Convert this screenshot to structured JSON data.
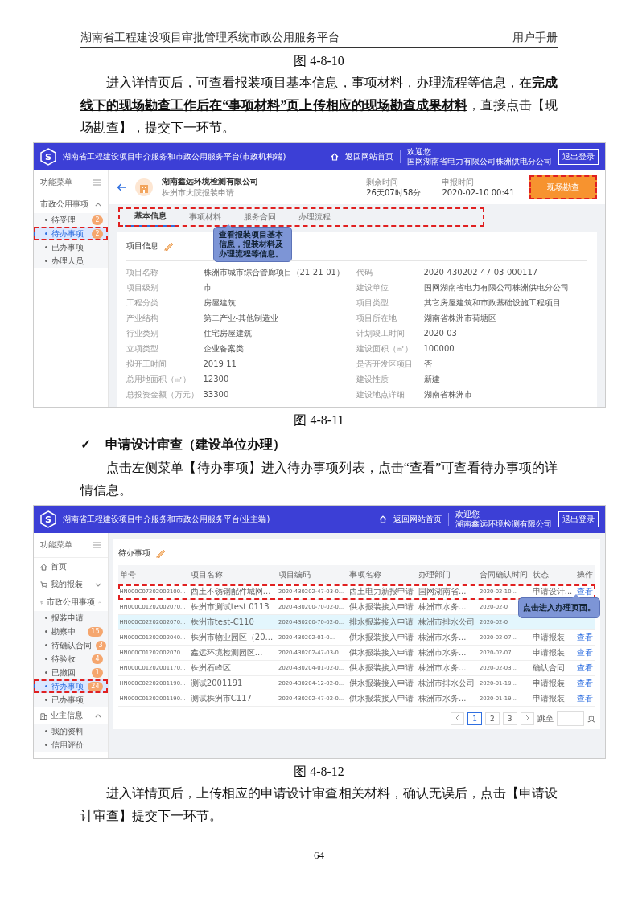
{
  "doc_header": {
    "title": "湖南省工程建设项目审批管理系统市政公用服务平台",
    "right": "用户手册"
  },
  "blocks": [
    {
      "kind": "caption",
      "text": "图 4-8-10"
    },
    {
      "kind": "paragraph",
      "text": "进入详情页后，可查看报装项目基本信息，事项材料，办理流程等信息，在**完成线下的现场勘查工作后在“事项材料”页上传相应的现场勘查成果材料**，直接点击【现场勘查】，提交下一环节。"
    },
    {
      "kind": "detail_screen",
      "app": {
        "logo": "S",
        "title": "湖南省工程建设项目中介服务和市政公用服务平台(市政机构端)",
        "home_link": "返回网站首页",
        "welcome": "欢迎您",
        "user": "国网湖南省电力有限公司株洲供电分公司",
        "logout": "退出登录"
      },
      "sidebar": {
        "title": "功能菜单",
        "items": [
          {
            "label": "市政公用事项",
            "kind": "plain",
            "expanded": true,
            "children": [
              {
                "label": "待受理",
                "badge": "2",
                "selected": false,
                "annotated": false
              },
              {
                "label": "待办事项",
                "badge": "2",
                "selected": true,
                "annotated": true
              },
              {
                "label": "已办事项",
                "selected": false,
                "annotated": false
              },
              {
                "label": "办理人员",
                "selected": false,
                "annotated": false
              }
            ]
          }
        ]
      },
      "company": "湖南鑫远环境检测有限公司",
      "subtitle": "株洲市大院报装申请",
      "stats": [
        {
          "label": "剩余时间",
          "value": "26天07时58分"
        },
        {
          "label": "申报时间",
          "value": "2020-02-10 00:41"
        }
      ],
      "action": {
        "label": "现场勘查",
        "annotated": true
      },
      "tabs_annotated": true,
      "tabs": [
        {
          "label": "基本信息",
          "selected": true
        },
        {
          "label": "事项材料",
          "selected": false
        },
        {
          "label": "服务合同",
          "selected": false
        },
        {
          "label": "办理流程",
          "selected": false
        }
      ],
      "callout": "查看报装项目基本信息，报装材料及办理流程等信息。",
      "card_title": "项目信息",
      "fields": [
        {
          "label": "项目名称",
          "value": "株洲市城市综合管廊项目（21-21-01）"
        },
        {
          "label": "代码",
          "value": "2020-430202-47-03-000117"
        },
        {
          "label": "项目级别",
          "value": "市"
        },
        {
          "label": "建设单位",
          "value": "国网湖南省电力有限公司株洲供电分公司"
        },
        {
          "label": "工程分类",
          "value": "房屋建筑"
        },
        {
          "label": "项目类型",
          "value": "其它房屋建筑和市政基础设施工程项目"
        },
        {
          "label": "产业结构",
          "value": "第二产业-其他制造业"
        },
        {
          "label": "项目所在地",
          "value": "湖南省株洲市荷塘区"
        },
        {
          "label": "行业类别",
          "value": "住宅房屋建筑"
        },
        {
          "label": "计划竣工时间",
          "value": "2020 03"
        },
        {
          "label": "立项类型",
          "value": "企业备案类"
        },
        {
          "label": "建设面积（㎡）",
          "value": "100000"
        },
        {
          "label": "拟开工时间",
          "value": "2019 11"
        },
        {
          "label": "是否开发区项目",
          "value": "否"
        },
        {
          "label": "总用地面积（㎡）",
          "value": "12300"
        },
        {
          "label": "建设性质",
          "value": "新建"
        },
        {
          "label": "总投资金额（万元）",
          "value": "33300"
        },
        {
          "label": "建设地点详细",
          "value": "湖南省株洲市"
        }
      ]
    },
    {
      "kind": "caption",
      "text": "图 4-8-11"
    },
    {
      "kind": "heading",
      "mark": "✓",
      "text": "申请设计审查（建设单位办理）"
    },
    {
      "kind": "paragraph",
      "text": "点击左侧菜单【待办事项】进入待办事项列表，点击“查看”可查看待办事项的详情信息。"
    },
    {
      "kind": "list_screen",
      "app": {
        "logo": "S",
        "title": "湖南省工程建设项目中介服务和市政公用服务平台(业主端)",
        "home_link": "返回网站首页",
        "welcome": "欢迎您",
        "user": "湖南鑫远环境检测有限公司",
        "logout": "退出登录"
      },
      "sidebar": {
        "title": "功能菜单",
        "items": [
          {
            "label": "首页",
            "kind": "home"
          },
          {
            "label": "我的报装",
            "kind": "cart",
            "expanded": false
          },
          {
            "label": "市政公用事项",
            "kind": "cart",
            "expanded": true,
            "children": [
              {
                "label": "报装申请",
                "selected": false,
                "annotated": false
              },
              {
                "label": "勘察中",
                "badge": "15",
                "selected": false,
                "annotated": false
              },
              {
                "label": "待确认合同",
                "badge": "3",
                "selected": false,
                "annotated": false
              },
              {
                "label": "待验收",
                "badge": "4",
                "selected": false,
                "annotated": false
              },
              {
                "label": "已撤回",
                "badge": "1",
                "selected": false,
                "annotated": false
              },
              {
                "label": "待办事项",
                "badge": "24",
                "selected": true,
                "annotated": true
              },
              {
                "label": "已办事项",
                "selected": false,
                "annotated": false
              }
            ]
          },
          {
            "label": "业主信息",
            "kind": "building",
            "expanded": true,
            "children": [
              {
                "label": "我的资料",
                "selected": false,
                "annotated": false
              },
              {
                "label": "信用评价",
                "selected": false,
                "annotated": false
              }
            ]
          }
        ]
      },
      "page_title": "待办事项",
      "columns": [
        "单号",
        "项目名称",
        "项目编码",
        "事项名称",
        "办理部门",
        "合同确认时间",
        "状态",
        "操作"
      ],
      "rows": [
        {
          "highlighted": false,
          "annotated": true,
          "cells": [
            "HN000C07202002100...",
            "西土不锈钢配件城网...",
            "2020-430202-47-03-0...",
            "西土电力新报申请",
            "国网湖南省...",
            "2020-02-10...",
            "申请设计...",
            "查看"
          ]
        },
        {
          "highlighted": false,
          "annotated": false,
          "cells": [
            "HN000C01202002070...",
            "株洲市测试test 0113",
            "2020-430200-70-02-0...",
            "供水报装接入申请",
            "株洲市水务...",
            "2020-02-0",
            null,
            null
          ]
        },
        {
          "highlighted": true,
          "annotated": false,
          "cells": [
            "HN000C02202002070...",
            "株洲市test-C110",
            "2020-430200-70-02-0...",
            "排水报装接入申请",
            "株洲市排水公司",
            "2020-02-0",
            null,
            null
          ]
        },
        {
          "highlighted": false,
          "annotated": false,
          "cells": [
            "HN000C01202002040...",
            "株洲市物业园区（20...",
            "2020-430202-01-0...",
            "供水报装接入申请",
            "株洲市水务...",
            "2020-02-07...",
            "申请报装",
            "查看"
          ]
        },
        {
          "highlighted": false,
          "annotated": false,
          "cells": [
            "HN000C01202002070...",
            "鑫远环境检测园区...",
            "2020-430202-47-03-0...",
            "供水报装接入申请",
            "株洲市水务...",
            "2020-02-07...",
            "申请报装",
            "查看"
          ]
        },
        {
          "highlighted": false,
          "annotated": false,
          "cells": [
            "HN000C01202001170...",
            "株洲石峰区",
            "2020-430204-01-02-0...",
            "供水报装接入申请",
            "株洲市水务...",
            "2020-02-03...",
            "确认合同",
            "查看"
          ]
        },
        {
          "highlighted": false,
          "annotated": false,
          "cells": [
            "HN000C02202001190...",
            "测试2001191",
            "2020-430204-12-02-0...",
            "供水报装接入申请",
            "株洲市排水公司",
            "2020-01-19...",
            "申请报装",
            "查看"
          ]
        },
        {
          "highlighted": false,
          "annotated": false,
          "cells": [
            "HN000C01202001190...",
            "测试株洲市C117",
            "2020-430202-47-02-0...",
            "供水报装接入申请",
            "株洲市水务...",
            "2020-01-19...",
            "申请报装",
            "查看"
          ]
        }
      ],
      "callout": "点击进入办理页面。",
      "pagination": {
        "pages": [
          {
            "label": "1",
            "selected": true
          },
          {
            "label": "2",
            "selected": false
          },
          {
            "label": "3",
            "selected": false
          }
        ],
        "jump_label": "跳至",
        "page_unit": "页"
      }
    },
    {
      "kind": "caption",
      "text": "图 4-8-12"
    },
    {
      "kind": "paragraph",
      "text": "进入详情页后，上传相应的申请设计审查相关材料，确认无误后，点击【申请设计审查】提交下一环节。"
    }
  ],
  "page_number": "64"
}
